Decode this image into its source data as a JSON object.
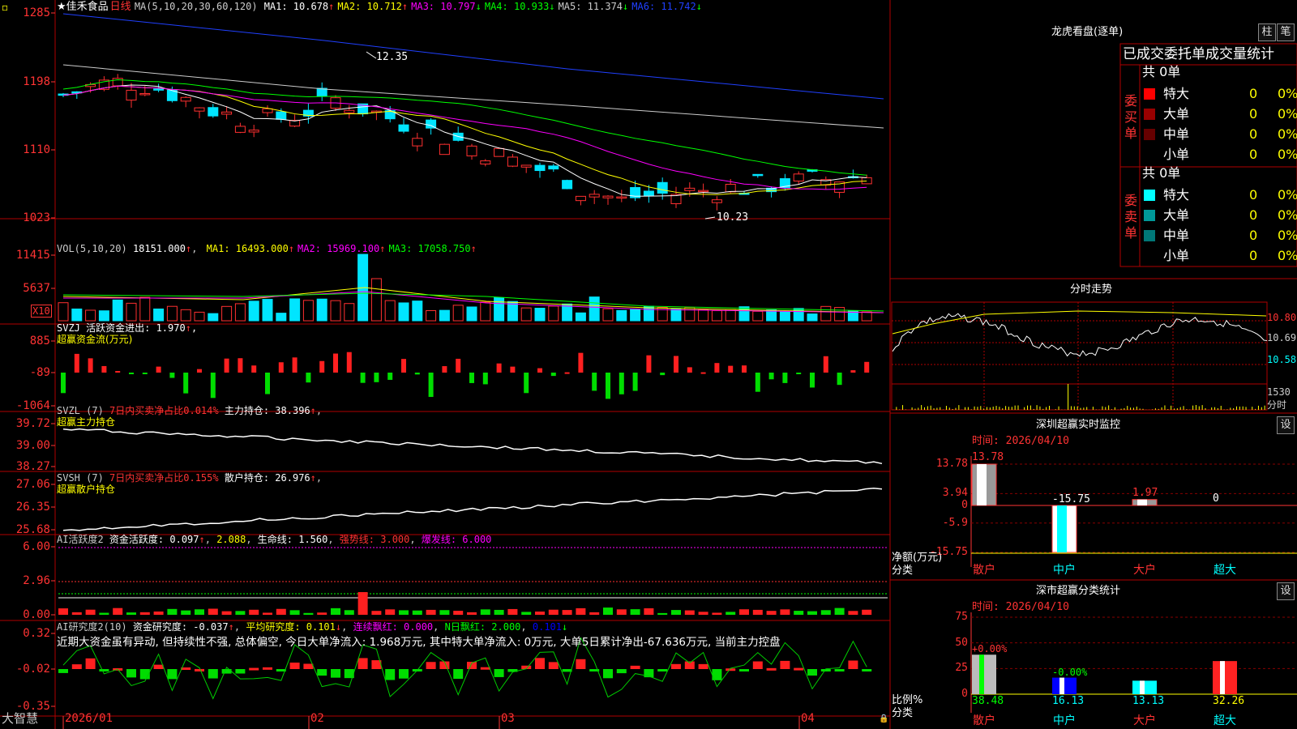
{
  "app": {
    "brand": "大智慧",
    "star": "★"
  },
  "stock": {
    "name": "佳禾食品",
    "period": "日线"
  },
  "kline": {
    "ma_label": "MA(5,10,20,30,60,120)",
    "ma_items": [
      {
        "label": "MA1: 10.678",
        "arrow": "↑",
        "color": "#ffffff"
      },
      {
        "label": "MA2: 10.712",
        "arrow": "↑",
        "color": "#ffff00"
      },
      {
        "label": "MA3: 10.797",
        "arrow": "↓",
        "color": "#ff00ff"
      },
      {
        "label": "MA4: 10.933",
        "arrow": "↓",
        "color": "#00ff00"
      },
      {
        "label": "MA5: 11.374",
        "arrow": "↓",
        "color": "#cccccc"
      },
      {
        "label": "MA6: 11.742",
        "arrow": "↓",
        "color": "#2040ff"
      }
    ],
    "y_ticks": [
      "1285",
      "1198",
      "1110",
      "1023"
    ],
    "high_mark": "12.35",
    "low_mark": "10.23"
  },
  "vol": {
    "label": "VOL(5,10,20)",
    "value": "18151.000",
    "ma_items": [
      {
        "label": "MA1: 16493.000",
        "color": "#ffff00"
      },
      {
        "label": "MA2: 15969.100",
        "color": "#ff00ff"
      },
      {
        "label": "MA3: 17058.750",
        "color": "#00ff00"
      }
    ],
    "y_ticks": [
      "11415",
      "5637"
    ],
    "unit": "X10"
  },
  "svzj": {
    "title": "SVZJ  活跃资金进出: 1.970",
    "subtitle": "超赢资金流(万元)",
    "y_ticks": [
      "885",
      "-89",
      "-1064"
    ]
  },
  "svzl": {
    "title": "SVZL (7)",
    "metric": "7日内买卖净占比0.014%",
    "holding": "主力持仓: 38.396",
    "subtitle": "超赢主力持仓",
    "y_ticks": [
      "39.72",
      "39.00",
      "38.27"
    ]
  },
  "svsh": {
    "title": "SVSH (7)",
    "metric": "7日内买卖净占比0.155%",
    "holding": "散户持仓: 26.976",
    "subtitle": "超赢散户持仓",
    "y_ticks": [
      "27.06",
      "26.35",
      "25.68"
    ]
  },
  "ai_active": {
    "title": "AI活跃度2",
    "metric": "资金活跃度: 0.097",
    "v2": "2.088",
    "life": "生命线: 1.560",
    "strong": "强势线: 3.000",
    "burst": "爆发线: 6.000",
    "y_ticks": [
      "6.00",
      "2.96",
      "0.00"
    ]
  },
  "ai_research": {
    "title": "AI研究度2(10)",
    "metric": "资金研究度: -0.037",
    "avg": "平均研究度: 0.101",
    "red": "连续飘红: 0.000",
    "nred": "N日飘红: 2.000",
    "last": "0.101",
    "comment": "近期大资金虽有异动, 但持续性不强, 总体偏空, 今日大单净流入: 1.968万元, 其中特大单净流入: 0万元, 大单5日累计净出-67.636万元, 当前主力控盘",
    "y_ticks": [
      "0.32",
      "-0.02",
      "-0.35"
    ]
  },
  "date_axis": [
    "2026/01",
    "02",
    "03",
    "04"
  ],
  "longhu": {
    "title": "龙虎看盘(逐单)",
    "btn_col": "柱",
    "btn_tick": "笔",
    "header": "已成交委托单成交量统计",
    "buy": {
      "side_label": "委买单",
      "total": "共 0单",
      "rows": [
        {
          "name": "特大",
          "count": "0",
          "pct": "0%",
          "color": "#ff0000"
        },
        {
          "name": "大单",
          "count": "0",
          "pct": "0%",
          "color": "#990000"
        },
        {
          "name": "中单",
          "count": "0",
          "pct": "0%",
          "color": "#660000"
        },
        {
          "name": "小单",
          "count": "0",
          "pct": "0%",
          "color": ""
        }
      ]
    },
    "sell": {
      "side_label": "委卖单",
      "total": "共 0单",
      "rows": [
        {
          "name": "特大",
          "count": "0",
          "pct": "0%",
          "color": "#00ffff"
        },
        {
          "name": "大单",
          "count": "0",
          "pct": "0%",
          "color": "#009999"
        },
        {
          "name": "中单",
          "count": "0",
          "pct": "0%",
          "color": "#007777"
        },
        {
          "name": "小单",
          "count": "0",
          "pct": "0%",
          "color": ""
        }
      ]
    }
  },
  "intraday": {
    "title": "分时走势",
    "y_ticks": [
      "10.80",
      "10.69",
      "10.58"
    ],
    "vol_tick": "1530",
    "unit": "分时"
  },
  "sz_monitor": {
    "title": "深圳超赢实时监控",
    "btn": "设",
    "time": "时间: 2026/04/10",
    "y_ticks": [
      "13.78",
      "3.94",
      "0",
      "-5.9",
      "-15.75"
    ],
    "axis_label": "净额(万元)",
    "cat_label": "分类",
    "categories": [
      "散户",
      "中户",
      "大户",
      "超大"
    ],
    "values": [
      13.78,
      -15.75,
      1.97,
      0
    ],
    "value_labels": [
      "13.78",
      "-15.75",
      "1.97",
      "0"
    ]
  },
  "sz_class": {
    "title": "深市超赢分类统计",
    "btn": "设",
    "time": "时间: 2026/04/10",
    "y_ticks": [
      "75",
      "50",
      "25",
      "0"
    ],
    "axis_label": "比例%",
    "cat_label": "分类",
    "categories": [
      "散户",
      "中户",
      "大户",
      "超大"
    ],
    "values": [
      38.48,
      16.13,
      13.13,
      32.26
    ],
    "value_labels": [
      "38.48",
      "16.13",
      "13.13",
      "32.26"
    ],
    "delta_labels": [
      "+0.00%",
      "-0.00%",
      "",
      ""
    ]
  },
  "chart_data": [
    {
      "type": "bar",
      "title": "深圳超赢实时监控",
      "ylabel": "净额(万元)",
      "categories": [
        "散户",
        "中户",
        "大户",
        "超大"
      ],
      "values": [
        13.78,
        -15.75,
        1.97,
        0
      ],
      "ylim": [
        -15.75,
        13.78
      ]
    },
    {
      "type": "bar",
      "title": "深市超赢分类统计",
      "ylabel": "比例%",
      "categories": [
        "散户",
        "中户",
        "大户",
        "超大"
      ],
      "values": [
        38.48,
        16.13,
        13.13,
        32.26
      ],
      "ylim": [
        0,
        75
      ]
    }
  ]
}
